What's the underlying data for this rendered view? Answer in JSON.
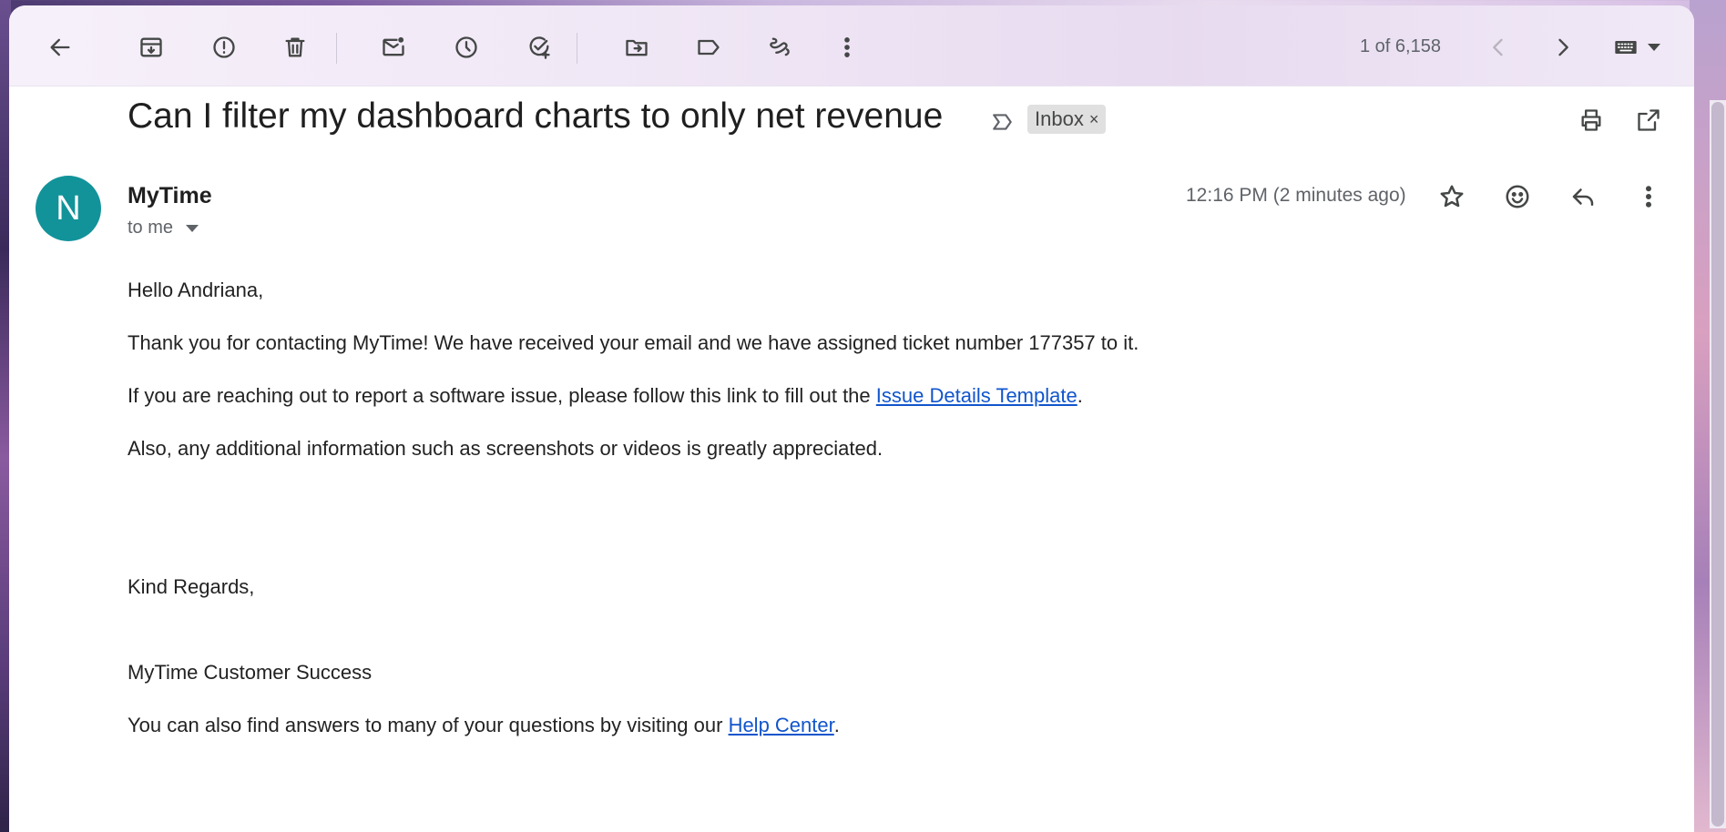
{
  "toolbar": {
    "pager_count": "1 of 6,158"
  },
  "email": {
    "subject": "Can I filter my dashboard charts to only net revenue",
    "label": "Inbox",
    "label_remove": "×",
    "sender_initial": "N",
    "sender_name": "MyTime",
    "recipient": "to me",
    "timestamp": "12:16 PM (2 minutes ago)"
  },
  "body": {
    "greeting": "Hello Andriana,",
    "line1": "Thank you for contacting MyTime! We have received your email and we have assigned ticket number 177357 to it.",
    "line2_prefix": "If you are reaching out to report a software issue, please follow this link to fill out the ",
    "line2_link": "Issue Details Template",
    "line2_suffix": ".",
    "line3": "Also, any additional information such as screenshots or videos is greatly appreciated.",
    "closing": "Kind Regards,",
    "signature": "MyTime Customer Success",
    "line4_prefix": "You can also find answers to many of your questions by visiting our ",
    "line4_link": "Help Center",
    "line4_suffix": "."
  },
  "colors": {
    "avatar": "#12939a",
    "link": "#1155cc",
    "chip": "#e0e0e0"
  },
  "icons": {
    "back": "arrow-left-icon",
    "archive": "archive-icon",
    "spam": "report-spam-icon",
    "delete": "trash-icon",
    "unread": "mark-unread-icon",
    "snooze": "clock-icon",
    "task": "add-task-icon",
    "move": "move-to-icon",
    "labels": "label-icon",
    "filter": "filter-messages-icon",
    "more": "more-vert-icon",
    "prev": "chevron-left-icon",
    "next": "chevron-right-icon",
    "keyboard": "keyboard-icon",
    "print": "print-icon",
    "popout": "open-new-window-icon",
    "star": "star-icon",
    "emoji": "emoji-icon",
    "reply": "reply-icon"
  }
}
